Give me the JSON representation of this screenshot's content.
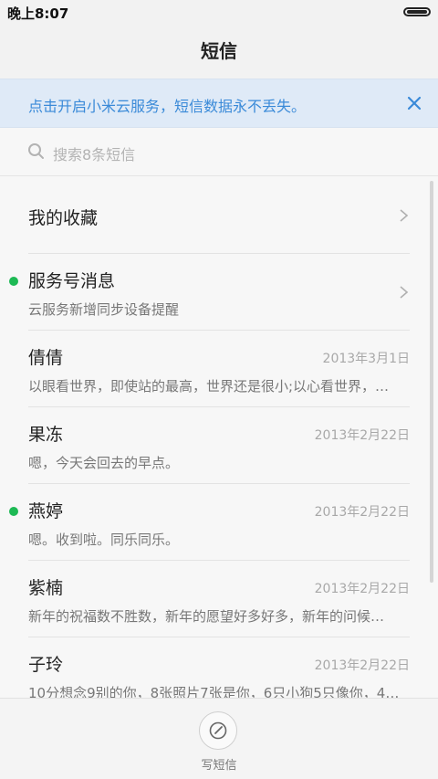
{
  "status_bar": {
    "time": "晚上8:07"
  },
  "header": {
    "title": "短信"
  },
  "banner": {
    "text": "点击开启小米云服务，短信数据永不丢失。",
    "close_icon": "close-icon"
  },
  "search": {
    "placeholder": "搜索8条短信",
    "icon": "search-icon"
  },
  "list": {
    "favorites": {
      "label": "我的收藏"
    },
    "service": {
      "title": "服务号消息",
      "subtitle": "云服务新增同步设备提醒",
      "unread": true
    },
    "messages": [
      {
        "name": "倩倩",
        "date": "2013年3月1日",
        "preview": "以眼看世界，即使站的最高，世界还是很小;以心看世界，…",
        "unread": false
      },
      {
        "name": "果冻",
        "date": "2013年2月22日",
        "preview": "嗯，今天会回去的早点。",
        "unread": false
      },
      {
        "name": "燕婷",
        "date": "2013年2月22日",
        "preview": "嗯。收到啦。同乐同乐。",
        "unread": true
      },
      {
        "name": "紫楠",
        "date": "2013年2月22日",
        "preview": "新年的祝福数不胜数，新年的愿望好多好多，新年的问候…",
        "unread": false
      },
      {
        "name": "子玲",
        "date": "2013年2月22日",
        "preview": "10分想念9别的你，8张照片7张是你，6只小狗5只像你，4…",
        "unread": false
      }
    ]
  },
  "bottom": {
    "compose_label": "写短信",
    "compose_icon": "compose-icon"
  },
  "colors": {
    "accent": "#3a8ad8",
    "unread": "#1db954",
    "banner_bg": "#dfeaf7"
  }
}
